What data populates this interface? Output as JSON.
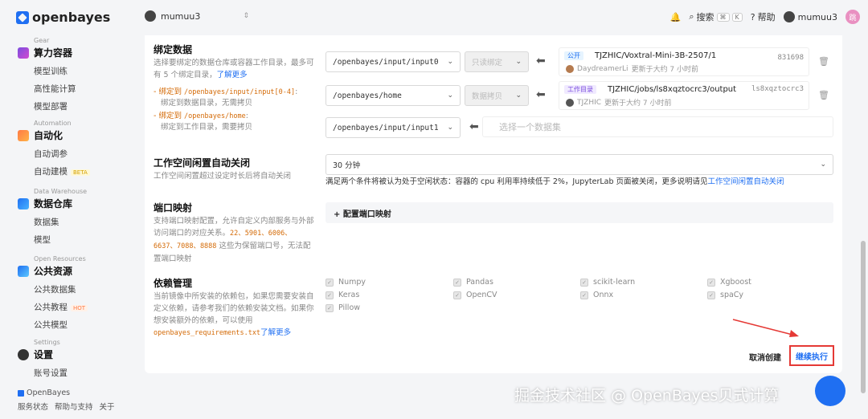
{
  "brand": {
    "name": "openbayes"
  },
  "user_switch": {
    "name": "mumuu3"
  },
  "header": {
    "search_label": "搜索",
    "kbd_ctrl": "⌘",
    "kbd_k": "K",
    "help_label": "帮助",
    "user_name": "mumuu3",
    "avatar_text": "跳"
  },
  "sidebar": {
    "gear": {
      "en": "Gear",
      "title": "算力容器",
      "items": [
        "模型训练",
        "高性能计算",
        "模型部署"
      ]
    },
    "automation": {
      "en": "Automation",
      "title": "自动化",
      "items": [
        "自动调参",
        "自动建模"
      ],
      "beta": "BETA"
    },
    "warehouse": {
      "en": "Data Warehouse",
      "title": "数据仓库",
      "items": [
        "数据集",
        "模型"
      ]
    },
    "open": {
      "en": "Open Resources",
      "title": "公共资源",
      "items": [
        "公共数据集",
        "公共教程",
        "公共模型"
      ],
      "hot": "HOT"
    },
    "settings": {
      "en": "Settings",
      "title": "设置",
      "items": [
        "账号设置"
      ]
    },
    "footer": {
      "brand": "OpenBayes",
      "links": [
        "服务状态",
        "帮助与支持",
        "关于"
      ]
    }
  },
  "bind": {
    "title": "绑定数据",
    "desc": "选择要绑定的数据仓库或容器工作目录，最多可有 5 个绑定目录，",
    "learn_more": "了解更多",
    "b1_prefix": "- 绑定到 ",
    "b1_code": "/openbayes/input/input[0-4]",
    "b1_suffix": ":",
    "b1_note": "绑定到数据目录，无需拷贝",
    "b2_prefix": "- 绑定到 ",
    "b2_code": "/openbayes/home",
    "b2_suffix": ":",
    "b2_note": "绑定到工作目录，需要拷贝",
    "rows": [
      {
        "path": "/openbayes/input/input0",
        "mode": "只读绑定",
        "tag": "公开",
        "name": "TJZHIC/Voxtral-Mini-3B-2507/1",
        "id": "831698",
        "owner": "DaydreamerLi",
        "updated": "更新于大约 7 小时前"
      },
      {
        "path": "/openbayes/home",
        "mode": "数据拷贝",
        "tag": "工作目录",
        "name": "TJZHIC/jobs/ls8xqztocrc3/output",
        "id": "ls8xqztocrc3",
        "owner": "TJZHIC",
        "updated": "更新于大约 7 小时前"
      },
      {
        "path": "/openbayes/input/input1",
        "placeholder": "选择一个数据集"
      }
    ]
  },
  "idle": {
    "title": "工作空间闲置自动关闭",
    "desc": "工作空间闲置超过设定时长后将自动关闭",
    "value": "30 分钟",
    "note": "满足两个条件将被认为处于空闲状态：容器的 cpu 利用率持续低于 2%，JupyterLab 页面被关闭，更多说明请见",
    "note_link": "工作空间闲置自动关闭"
  },
  "ports": {
    "title": "端口映射",
    "desc_a": "支持端口映射配置，允许自定义内部服务与外部访问端口的对应关系。",
    "reserved": "22、5901、6006、6637、7088、8888",
    "desc_b": " 这些为保留端口号，无法配置端口映射",
    "bar_label": "+ 配置端口映射"
  },
  "deps": {
    "title": "依赖管理",
    "desc": "当前镜像中所安装的依赖包，如果您需要安装自定义依赖，请参考我们的依赖安装文档。如果你想安装额外的依赖，可以使用 ",
    "code": "openbayes_requirements.txt",
    "learn_more": "了解更多",
    "items": [
      "Numpy",
      "Pandas",
      "scikit-learn",
      "Xgboost",
      "Keras",
      "OpenCV",
      "Onnx",
      "spaCy",
      "Pillow"
    ]
  },
  "actions": {
    "cancel": "取消创建",
    "continue": "继续执行"
  },
  "watermark": "掘金技术社区 @ OpenBayes贝式计算"
}
